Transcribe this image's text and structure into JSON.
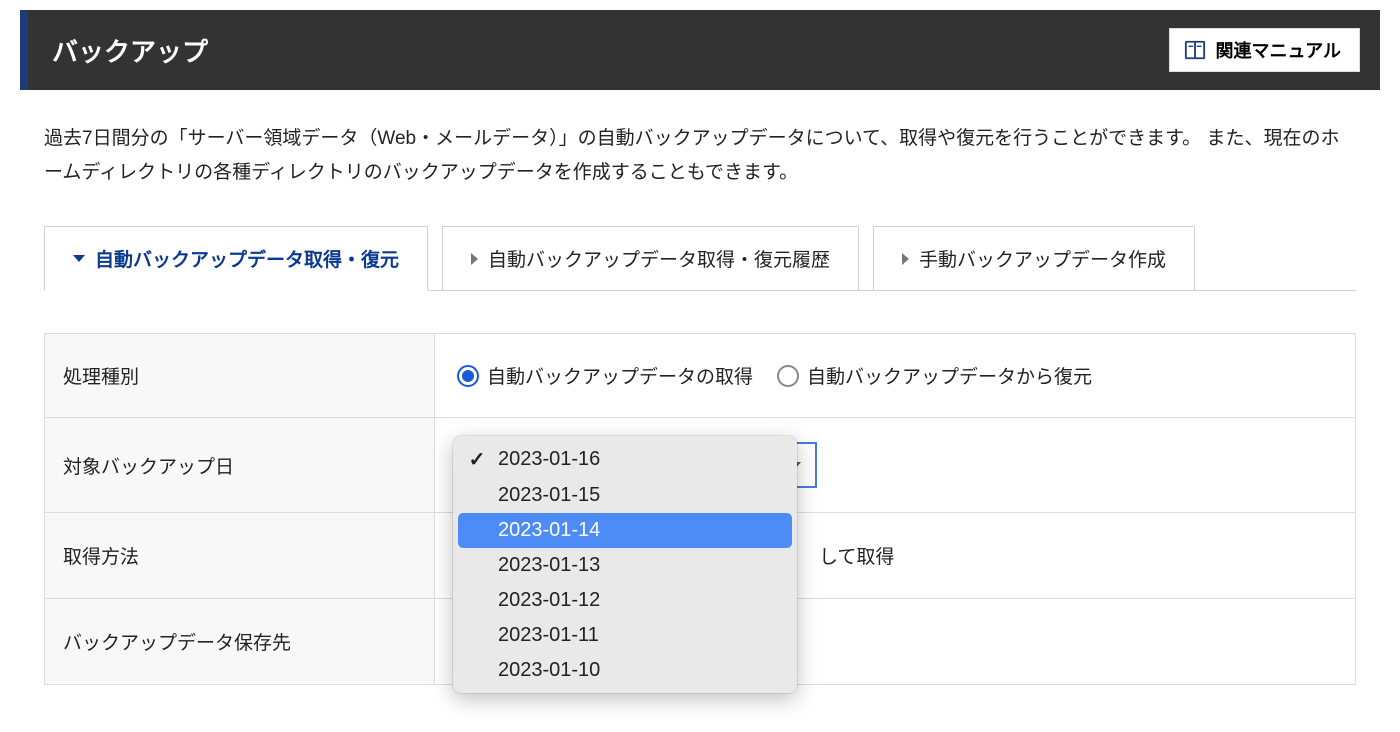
{
  "header": {
    "title": "バックアップ",
    "manual_button": "関連マニュアル"
  },
  "description": "過去7日間分の「サーバー領域データ（Web・メールデータ）」の自動バックアップデータについて、取得や復元を行うことができます。 また、現在のホームディレクトリの各種ディレクトリのバックアップデータを作成することもできます。",
  "tabs": [
    {
      "label": "自動バックアップデータ取得・復元",
      "active": true
    },
    {
      "label": "自動バックアップデータ取得・復元履歴",
      "active": false
    },
    {
      "label": "手動バックアップデータ作成",
      "active": false
    }
  ],
  "form": {
    "row_process_type": {
      "label": "処理種別",
      "option1": "自動バックアップデータの取得",
      "option2": "自動バックアップデータから復元",
      "selected": "option1"
    },
    "row_backup_date": {
      "label": "対象バックアップ日"
    },
    "row_method": {
      "label": "取得方法",
      "value_fragment": "して取得"
    },
    "row_destination": {
      "label": "バックアップデータ保存先"
    }
  },
  "dropdown": {
    "selected": "2023-01-16",
    "highlighted": "2023-01-14",
    "options": [
      "2023-01-16",
      "2023-01-15",
      "2023-01-14",
      "2023-01-13",
      "2023-01-12",
      "2023-01-11",
      "2023-01-10"
    ]
  }
}
